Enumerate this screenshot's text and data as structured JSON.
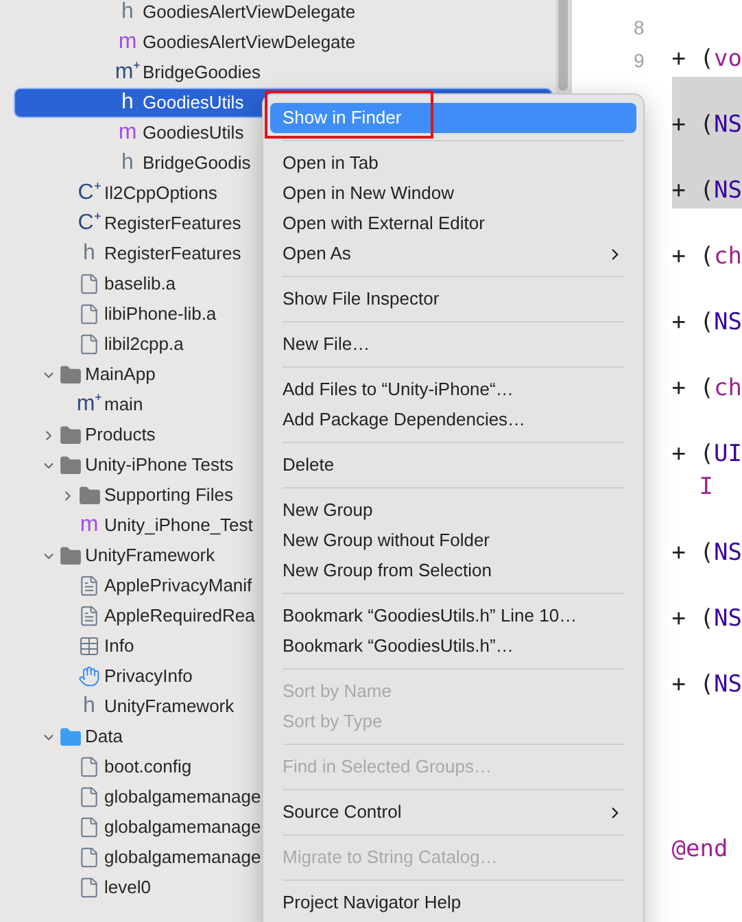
{
  "navigator": {
    "tree": [
      {
        "children": [
          {
            "children": [
              {
                "children": [
                  {
                    "label": "GoodiesAlertViewDelegate",
                    "kind": "header",
                    "glyph": "h",
                    "selected": false
                  },
                  {
                    "label": "GoodiesAlertViewDelegate",
                    "kind": "objc",
                    "glyph": "m",
                    "selected": false
                  },
                  {
                    "label": "BridgeGoodies",
                    "kind": "objcpp",
                    "glyph": "m⁺",
                    "selected": false
                  },
                  {
                    "label": "GoodiesUtils",
                    "kind": "header",
                    "glyph": "h",
                    "selected": true
                  },
                  {
                    "label": "GoodiesUtils",
                    "kind": "objc",
                    "glyph": "m",
                    "selected": false
                  },
                  {
                    "label": "BridgeGoodis",
                    "kind": "header",
                    "glyph": "h",
                    "selected": false
                  }
                ]
              }
            ]
          },
          {
            "label": "Il2CppOptions",
            "kind": "cpp",
            "glyph": "C⁺",
            "selected": false
          },
          {
            "label": "RegisterFeatures",
            "kind": "cpp",
            "glyph": "C⁺",
            "selected": false
          },
          {
            "label": "RegisterFeatures",
            "kind": "header",
            "glyph": "h",
            "selected": false
          },
          {
            "label": "baselib.a",
            "kind": "file",
            "selected": false
          },
          {
            "label": "libiPhone-lib.a",
            "kind": "file",
            "selected": false
          },
          {
            "label": "libil2cpp.a",
            "kind": "file",
            "selected": false
          }
        ]
      },
      {
        "label": "MainApp",
        "kind": "folder",
        "expanded": true,
        "selected": false,
        "children": [
          {
            "label": "main",
            "kind": "objcpp",
            "glyph": "m⁺",
            "selected": false
          }
        ]
      },
      {
        "label": "Products",
        "kind": "folder",
        "expanded": false,
        "selected": false
      },
      {
        "label": "Unity-iPhone Tests",
        "kind": "folder",
        "expanded": true,
        "selected": false,
        "children": [
          {
            "label": "Supporting Files",
            "kind": "folder",
            "expanded": false,
            "selected": false
          },
          {
            "label": "Unity_iPhone_Test",
            "kind": "objc",
            "glyph": "m",
            "selected": false
          }
        ]
      },
      {
        "label": "UnityFramework",
        "kind": "folder",
        "expanded": true,
        "selected": false,
        "children": [
          {
            "label": "ApplePrivacyManif",
            "kind": "text",
            "selected": false
          },
          {
            "label": "AppleRequiredRea",
            "kind": "text",
            "selected": false
          },
          {
            "label": "Info",
            "kind": "table",
            "selected": false
          },
          {
            "label": "PrivacyInfo",
            "kind": "privacy",
            "selected": false
          },
          {
            "label": "UnityFramework",
            "kind": "header",
            "glyph": "h",
            "selected": false
          }
        ]
      },
      {
        "label": "Data",
        "kind": "blue-folder",
        "expanded": true,
        "selected": false,
        "children": [
          {
            "label": "boot.config",
            "kind": "file",
            "selected": false
          },
          {
            "label": "globalgamemanage",
            "kind": "file",
            "selected": false
          },
          {
            "label": "globalgamemanage",
            "kind": "file",
            "selected": false
          },
          {
            "label": "globalgamemanage",
            "kind": "file",
            "selected": false
          },
          {
            "label": "level0",
            "kind": "file",
            "selected": false
          }
        ]
      }
    ]
  },
  "editor": {
    "lines": [
      {
        "number": "8",
        "highlighted": false
      },
      {
        "number": "9",
        "highlighted": false,
        "tokens": [
          {
            "text": "+ (",
            "kind": "plain"
          },
          {
            "text": "vo",
            "kind": "keyword"
          }
        ]
      },
      {
        "highlighted": true
      },
      {
        "highlighted": true,
        "tokens": [
          {
            "text": "+ (",
            "kind": "plain"
          },
          {
            "text": "NS",
            "kind": "type"
          }
        ]
      },
      {
        "highlighted": true
      },
      {
        "highlighted": true,
        "tokens": [
          {
            "text": "+ (",
            "kind": "plain"
          },
          {
            "text": "NS",
            "kind": "type"
          }
        ]
      },
      {
        "highlighted": false
      },
      {
        "highlighted": false,
        "tokens": [
          {
            "text": "+ (",
            "kind": "plain"
          },
          {
            "text": "ch",
            "kind": "keyword"
          }
        ]
      },
      {
        "highlighted": false
      },
      {
        "highlighted": false,
        "tokens": [
          {
            "text": "+ (",
            "kind": "plain"
          },
          {
            "text": "NS",
            "kind": "type"
          }
        ]
      },
      {
        "highlighted": false
      },
      {
        "highlighted": false,
        "tokens": [
          {
            "text": "+ (",
            "kind": "plain"
          },
          {
            "text": "ch",
            "kind": "keyword"
          }
        ]
      },
      {
        "highlighted": false
      },
      {
        "highlighted": false,
        "tokens": [
          {
            "text": "+ (",
            "kind": "plain"
          },
          {
            "text": "UI",
            "kind": "type"
          }
        ]
      },
      {
        "highlighted": false,
        "indented": true,
        "tokens": [
          {
            "text": "I",
            "kind": "keyword"
          }
        ]
      },
      {
        "highlighted": false
      },
      {
        "highlighted": false,
        "tokens": [
          {
            "text": "+ (",
            "kind": "plain"
          },
          {
            "text": "NS",
            "kind": "type"
          }
        ]
      },
      {
        "highlighted": false
      },
      {
        "highlighted": false,
        "tokens": [
          {
            "text": "+ (",
            "kind": "plain"
          },
          {
            "text": "NS",
            "kind": "type"
          }
        ]
      },
      {
        "highlighted": false
      },
      {
        "highlighted": false,
        "tokens": [
          {
            "text": "+ (",
            "kind": "plain"
          },
          {
            "text": "NS",
            "kind": "type"
          }
        ]
      },
      {
        "highlighted": false
      },
      {
        "highlighted": false
      },
      {
        "highlighted": false
      },
      {
        "highlighted": false
      },
      {
        "highlighted": false,
        "tokens": [
          {
            "text": "@end",
            "kind": "keyword"
          }
        ]
      }
    ]
  },
  "context_menu": {
    "groups": [
      [
        {
          "label": "Show in Finder",
          "selected": true,
          "outlined": true,
          "disabled": false,
          "submenu": false
        }
      ],
      [
        {
          "label": "Open in Tab",
          "selected": false,
          "outlined": false,
          "disabled": false,
          "submenu": false
        },
        {
          "label": "Open in New Window",
          "selected": false,
          "outlined": false,
          "disabled": false,
          "submenu": false
        },
        {
          "label": "Open with External Editor",
          "selected": false,
          "outlined": false,
          "disabled": false,
          "submenu": false
        },
        {
          "label": "Open As",
          "selected": false,
          "outlined": false,
          "disabled": false,
          "submenu": true
        }
      ],
      [
        {
          "label": "Show File Inspector",
          "selected": false,
          "outlined": false,
          "disabled": false,
          "submenu": false
        }
      ],
      [
        {
          "label": "New File…",
          "selected": false,
          "outlined": false,
          "disabled": false,
          "submenu": false
        }
      ],
      [
        {
          "label": "Add Files to “Unity-iPhone“…",
          "selected": false,
          "outlined": false,
          "disabled": false,
          "submenu": false
        },
        {
          "label": "Add Package Dependencies…",
          "selected": false,
          "outlined": false,
          "disabled": false,
          "submenu": false
        }
      ],
      [
        {
          "label": "Delete",
          "selected": false,
          "outlined": false,
          "disabled": false,
          "submenu": false
        }
      ],
      [
        {
          "label": "New Group",
          "selected": false,
          "outlined": false,
          "disabled": false,
          "submenu": false
        },
        {
          "label": "New Group without Folder",
          "selected": false,
          "outlined": false,
          "disabled": false,
          "submenu": false
        },
        {
          "label": "New Group from Selection",
          "selected": false,
          "outlined": false,
          "disabled": false,
          "submenu": false
        }
      ],
      [
        {
          "label": "Bookmark “GoodiesUtils.h” Line 10…",
          "selected": false,
          "outlined": false,
          "disabled": false,
          "submenu": false
        },
        {
          "label": "Bookmark “GoodiesUtils.h”…",
          "selected": false,
          "outlined": false,
          "disabled": false,
          "submenu": false
        }
      ],
      [
        {
          "label": "Sort by Name",
          "selected": false,
          "outlined": false,
          "disabled": true,
          "submenu": false
        },
        {
          "label": "Sort by Type",
          "selected": false,
          "outlined": false,
          "disabled": true,
          "submenu": false
        }
      ],
      [
        {
          "label": "Find in Selected Groups…",
          "selected": false,
          "outlined": false,
          "disabled": true,
          "submenu": false
        }
      ],
      [
        {
          "label": "Source Control",
          "selected": false,
          "outlined": false,
          "disabled": false,
          "submenu": true
        }
      ],
      [
        {
          "label": "Migrate to String Catalog…",
          "selected": false,
          "outlined": false,
          "disabled": true,
          "submenu": false
        }
      ],
      [
        {
          "label": "Project Navigator Help",
          "selected": false,
          "outlined": false,
          "disabled": false,
          "submenu": false
        }
      ]
    ]
  }
}
